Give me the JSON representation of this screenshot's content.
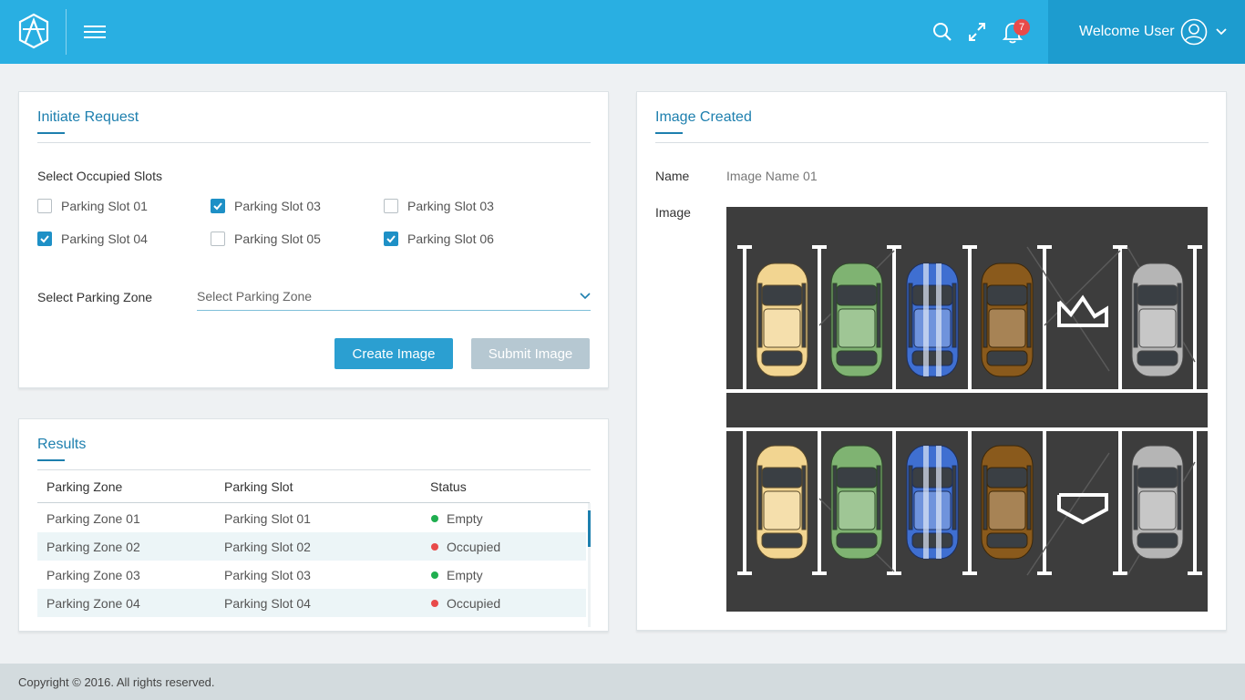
{
  "header": {
    "welcome": "Welcome User",
    "notification_count": "7",
    "accent": "#29afe2",
    "icons": [
      "logo-icon",
      "menu-icon",
      "search-icon",
      "expand-icon",
      "bell-icon",
      "user-icon",
      "chevron-down-icon"
    ]
  },
  "initiate": {
    "title": "Initiate Request",
    "occupied_label": "Select  Occupied Slots",
    "slots": [
      {
        "label": "Parking Slot 01",
        "checked": false
      },
      {
        "label": "Parking Slot 03",
        "checked": true
      },
      {
        "label": "Parking Slot 03",
        "checked": false
      },
      {
        "label": "Parking Slot 04",
        "checked": true
      },
      {
        "label": "Parking Slot 05",
        "checked": false
      },
      {
        "label": "Parking Slot 06",
        "checked": true
      }
    ],
    "zone_label": "Select Parking Zone",
    "zone_placeholder": "Select Parking Zone",
    "create_button": "Create Image",
    "submit_button": "Submit Image"
  },
  "results": {
    "title": "Results",
    "columns": [
      "Parking Zone",
      "Parking Slot",
      "Status"
    ],
    "rows": [
      {
        "zone": "Parking Zone 01",
        "slot": "Parking Slot 01",
        "status": "Empty",
        "status_color": "#1fae4f"
      },
      {
        "zone": "Parking Zone 02",
        "slot": "Parking Slot 02",
        "status": "Occupied",
        "status_color": "#e84a4a"
      },
      {
        "zone": "Parking Zone 03",
        "slot": "Parking Slot 03",
        "status": "Empty",
        "status_color": "#1fae4f"
      },
      {
        "zone": "Parking Zone 04",
        "slot": "Parking Slot 04",
        "status": "Occupied",
        "status_color": "#e84a4a"
      }
    ]
  },
  "image_created": {
    "title": "Image Created",
    "name_label": "Name",
    "name_value": "Image Name 01",
    "image_label": "Image"
  },
  "footer": {
    "text": "Copyright © 2016.  All rights reserved."
  }
}
